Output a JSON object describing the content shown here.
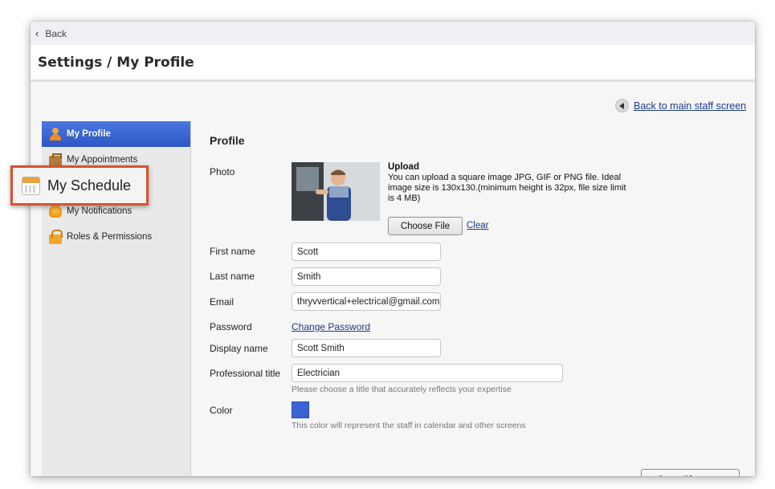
{
  "nav": {
    "back_label": "Back",
    "back_icon": "chevron-left-icon"
  },
  "header": {
    "title": "Settings / My Profile"
  },
  "back_to_main": {
    "label": "Back to main staff screen",
    "icon": "arrow-left-circle-icon"
  },
  "sidebar": {
    "items": [
      {
        "label": "My Profile",
        "icon": "person-icon",
        "active": true
      },
      {
        "label": "My Appointments",
        "icon": "briefcase-icon",
        "active": false
      },
      {
        "label": "My Notifications",
        "icon": "bell-icon",
        "active": false
      },
      {
        "label": "Roles & Permissions",
        "icon": "lock-icon",
        "active": false
      }
    ]
  },
  "callout": {
    "label": "My Schedule",
    "icon": "calendar-icon",
    "border_color": "#d5532f"
  },
  "profile": {
    "section_title": "Profile",
    "photo_label": "Photo",
    "upload_title": "Upload",
    "upload_description": "You can upload a square image JPG, GIF or PNG file. Ideal image size is 130x130.(minimum height is 32px, file size limit is 4 MB)",
    "choose_file_label": "Choose File",
    "clear_label": "Clear",
    "first_name_label": "First name",
    "first_name_value": "Scott",
    "last_name_label": "Last name",
    "last_name_value": "Smith",
    "email_label": "Email",
    "email_value": "thryvvertical+electrical@gmail.com",
    "password_label": "Password",
    "change_password_label": "Change Password",
    "display_name_label": "Display name",
    "display_name_value": "Scott Smith",
    "professional_title_label": "Professional title",
    "professional_title_value": "Electrician",
    "professional_title_hint": "Please choose a title that accurately reflects your expertise",
    "color_label": "Color",
    "color_value": "#3b63d6",
    "color_hint": "This color will represent the staff in calendar and other screens",
    "save_label": "Save Changes"
  },
  "colors": {
    "accent": "#2f5bcb",
    "link": "#1d3a8a"
  }
}
